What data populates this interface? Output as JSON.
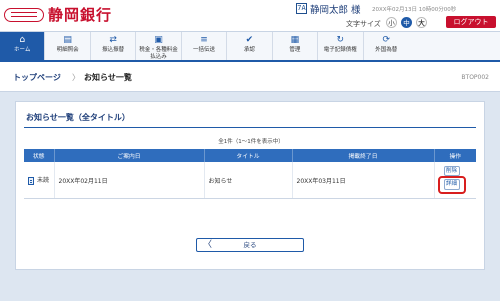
{
  "header": {
    "bank_name": "静岡銀行",
    "user_icon_text": "7A",
    "user_name": "静岡太郎 様",
    "login_time": "20XX年02月13日 10時00分00秒",
    "font_size_label": "文字サイズ",
    "font_small": "小",
    "font_medium": "中",
    "font_large": "大",
    "logout_label": "ログアウト"
  },
  "nav": {
    "items": [
      {
        "label": "ホーム",
        "icon": "home-icon",
        "glyph": "⌂",
        "active": true
      },
      {
        "label": "明細照会",
        "icon": "document-icon",
        "glyph": "▤",
        "active": false
      },
      {
        "label": "振込振替",
        "icon": "transfer-icon",
        "glyph": "⇄",
        "active": false
      },
      {
        "label": "税金・各種料金\n払込み",
        "icon": "bill-icon",
        "glyph": "▣",
        "active": false
      },
      {
        "label": "一括伝送",
        "icon": "database-icon",
        "glyph": "≡",
        "active": false
      },
      {
        "label": "承認",
        "icon": "approve-icon",
        "glyph": "✔",
        "active": false
      },
      {
        "label": "管理",
        "icon": "admin-icon",
        "glyph": "▦",
        "active": false
      },
      {
        "label": "電子記録債権",
        "icon": "cycle-icon",
        "glyph": "↻",
        "active": false
      },
      {
        "label": "外国為替",
        "icon": "exchange-icon",
        "glyph": "⟳",
        "active": false
      }
    ]
  },
  "breadcrumb": {
    "top": "トップページ",
    "separator": "〉",
    "current": "お知らせ一覧",
    "screen_id": "BTOP002"
  },
  "panel": {
    "title": "お知らせ一覧（全タイトル）",
    "count_text": "全1件（1〜1件を表示中）",
    "columns": [
      "状態",
      "ご案内日",
      "タイトル",
      "掲載終了日",
      "操作"
    ],
    "rows": [
      {
        "status": "未読",
        "date": "20XX年02月11日",
        "title": "お知らせ",
        "end_date": "20XX年03月11日"
      }
    ],
    "delete_label": "削除",
    "detail_label": "詳細",
    "back_arrow": "〈",
    "back_label": "戻る"
  },
  "colors": {
    "brand_red": "#c8102e",
    "nav_active": "#1f5aa8",
    "table_header": "#2f6dbd",
    "highlight_ring": "#d81e1e"
  }
}
